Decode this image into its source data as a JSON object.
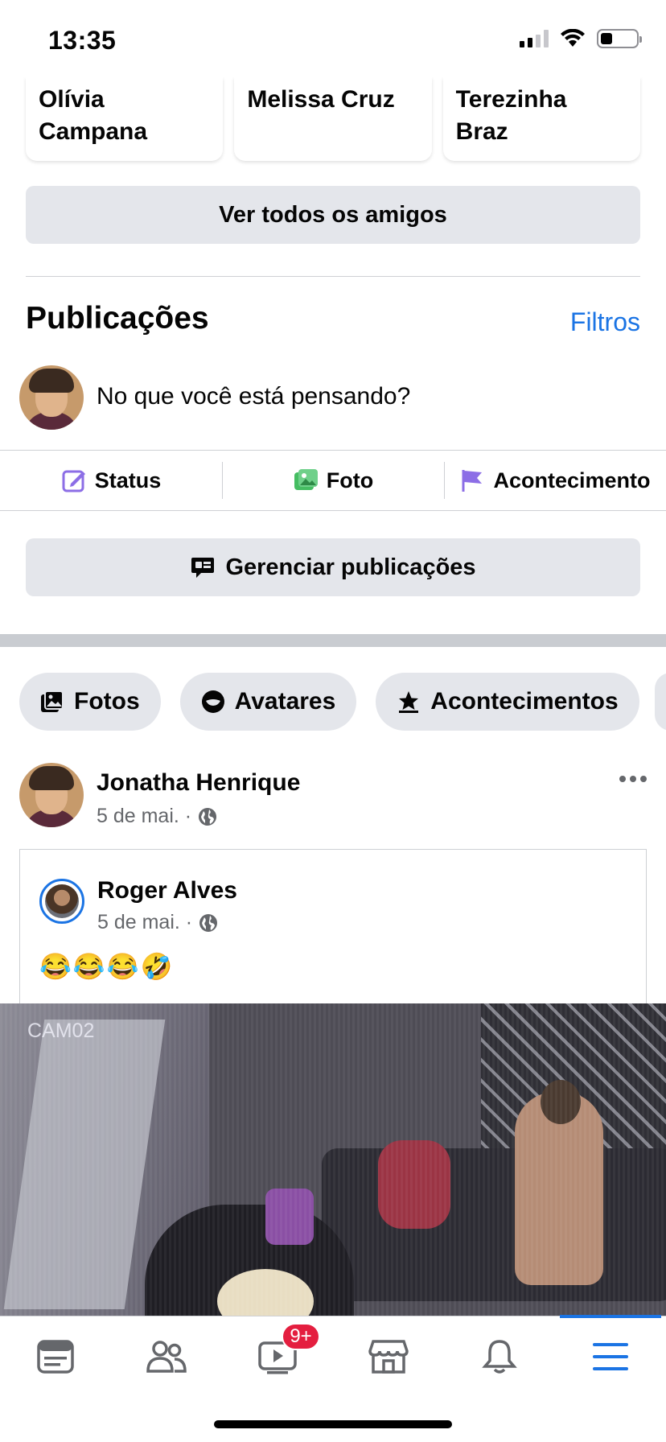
{
  "status_bar": {
    "time": "13:35"
  },
  "friends": [
    {
      "name": "Olívia\nCampana"
    },
    {
      "name": "Melissa Cruz"
    },
    {
      "name": "Terezinha\nBraz"
    }
  ],
  "see_all_friends": "Ver todos os amigos",
  "posts_section": {
    "title": "Publicações",
    "filters": "Filtros",
    "composer_placeholder": "No que você está pensando?",
    "actions": [
      {
        "label": "Status"
      },
      {
        "label": "Foto"
      },
      {
        "label": "Acontecimento"
      }
    ],
    "manage_button": "Gerenciar publicações"
  },
  "chips": [
    {
      "label": "Fotos"
    },
    {
      "label": "Avatares"
    },
    {
      "label": "Acontecimentos"
    }
  ],
  "post": {
    "author": "Jonatha Henrique",
    "date": "5 de mai. ·",
    "shared": {
      "author": "Roger Alves",
      "date": "5 de mai. ·",
      "text": "😂😂😂🤣"
    },
    "video_label": "CAM02"
  },
  "tabbar": {
    "watch_badge": "9+",
    "active_tab": "menu",
    "accent_color": "#1b74e4"
  }
}
